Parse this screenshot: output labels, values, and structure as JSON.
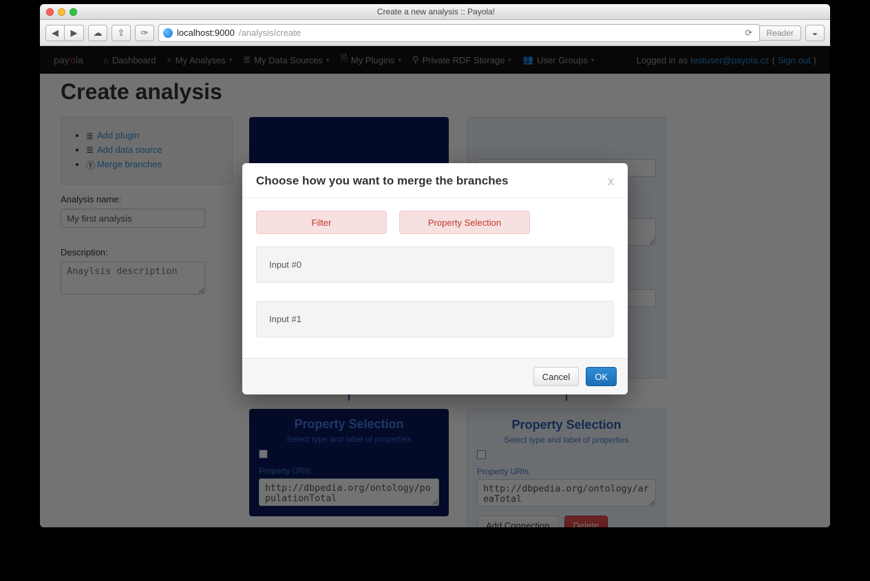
{
  "window": {
    "title": "Create a new analysis :: Payola!",
    "url_host": "localhost:9000",
    "url_path": "/analysis/create",
    "reader": "Reader"
  },
  "nav": {
    "brand": "payola",
    "items": [
      {
        "label": "Dashboard",
        "dropdown": false
      },
      {
        "label": "My Analyses",
        "dropdown": true
      },
      {
        "label": "My Data Sources",
        "dropdown": true
      },
      {
        "label": "My Plugins",
        "dropdown": true
      },
      {
        "label": "Private RDF Storage",
        "dropdown": true
      },
      {
        "label": "User Groups",
        "dropdown": true
      }
    ],
    "logged_in_prefix": "Logged in as ",
    "user": "testuser@payola.cz",
    "signout_open": "(",
    "signout": "Sign out",
    "signout_close": ")"
  },
  "page": {
    "title": "Create analysis",
    "sidebar": {
      "actions": [
        {
          "label": "Add plugin"
        },
        {
          "label": "Add data source"
        },
        {
          "label": "Merge branches"
        }
      ],
      "name_label": "Analysis name:",
      "name_value": "My first analysis",
      "desc_label": "Description:",
      "desc_placeholder": "Anaylsis description"
    },
    "columns": {
      "left": {
        "prop_sel_title": "Property Selection",
        "prop_sel_sub": "Select type and label of properties",
        "uris_label": "Property URIs",
        "uris_value": "http://dbpedia.org/ontology/populationTotal"
      },
      "right": {
        "prop_sel_title": "Property Selection",
        "prop_sel_sub": "Select type and label of properties",
        "uris_label": "Property URIs",
        "uris_value": "http://dbpedia.org/ontology/areaTotal",
        "add_conn": "Add Connection",
        "delete": "Delete"
      }
    }
  },
  "modal": {
    "title": "Choose how you want to merge the branches",
    "close": "x",
    "filter": "Filter",
    "property_selection": "Property Selection",
    "input0": "Input #0",
    "input1": "Input #1",
    "cancel": "Cancel",
    "ok": "OK"
  }
}
